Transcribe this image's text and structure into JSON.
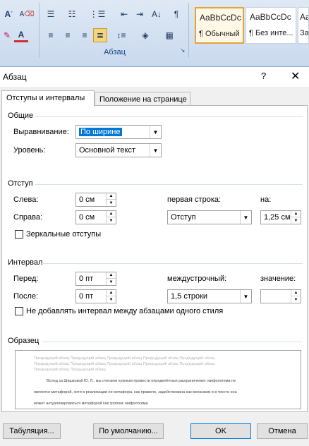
{
  "ribbon": {
    "paragraph_group_label": "Абзац",
    "styles": [
      {
        "sample": "AaBbCcDc",
        "name": "¶ Обычный",
        "selected": true
      },
      {
        "sample": "AaBbCcDc",
        "name": "¶ Без инте...",
        "selected": false
      },
      {
        "sample": "AaBb",
        "name": "За",
        "selected": false
      }
    ]
  },
  "dialog": {
    "title": "Абзац",
    "help": "?",
    "close": "✕",
    "tabs": [
      "Отступы и интервалы",
      "Положение на странице"
    ],
    "general": {
      "title": "Общие",
      "alignment_label": "Выравнивание:",
      "alignment_value": "По ширине",
      "level_label": "Уровень:",
      "level_value": "Основной текст"
    },
    "indent": {
      "title": "Отступ",
      "left_label": "Слева:",
      "left_value": "0 см",
      "right_label": "Справа:",
      "right_value": "0 см",
      "first_line_label": "первая строка:",
      "first_line_value": "Отступ",
      "by_label": "на:",
      "by_value": "1,25 см",
      "mirror_label": "Зеркальные отступы"
    },
    "spacing": {
      "title": "Интервал",
      "before_label": "Перед:",
      "before_value": "0 пт",
      "after_label": "После:",
      "after_value": "0 пт",
      "line_label": "междустрочный:",
      "line_value": "1,5 строки",
      "at_label": "значение:",
      "at_value": "",
      "no_space_label": "Не добавлять интервал между абзацами одного стиля"
    },
    "preview": {
      "title": "Образец",
      "prev_lines": [
        "Предыдущий абзац Предыдущий абзац Предыдущий абзац Предыдущий абзац Предыдущий абзац",
        "Предыдущий абзац Предыдущий абзац Предыдущий абзац Предыдущий абзац Предыдущий абзац",
        "Предыдущий абзац Предыдущий абзац"
      ],
      "text_lines": [
        "Вслед за Шишковой Ю. Л., мы считаем нужным провести определённые разграничения: мифологема не",
        "является метафорой, хотя в реализации ее метафора, как правило, задействована как механизм и в тексте она",
        "может актуализироваться метафорой как тропом; мифологема"
      ]
    },
    "buttons": {
      "tabs": "Табуляция...",
      "default": "По умолчанию...",
      "ok": "OK",
      "cancel": "Отмена"
    }
  }
}
